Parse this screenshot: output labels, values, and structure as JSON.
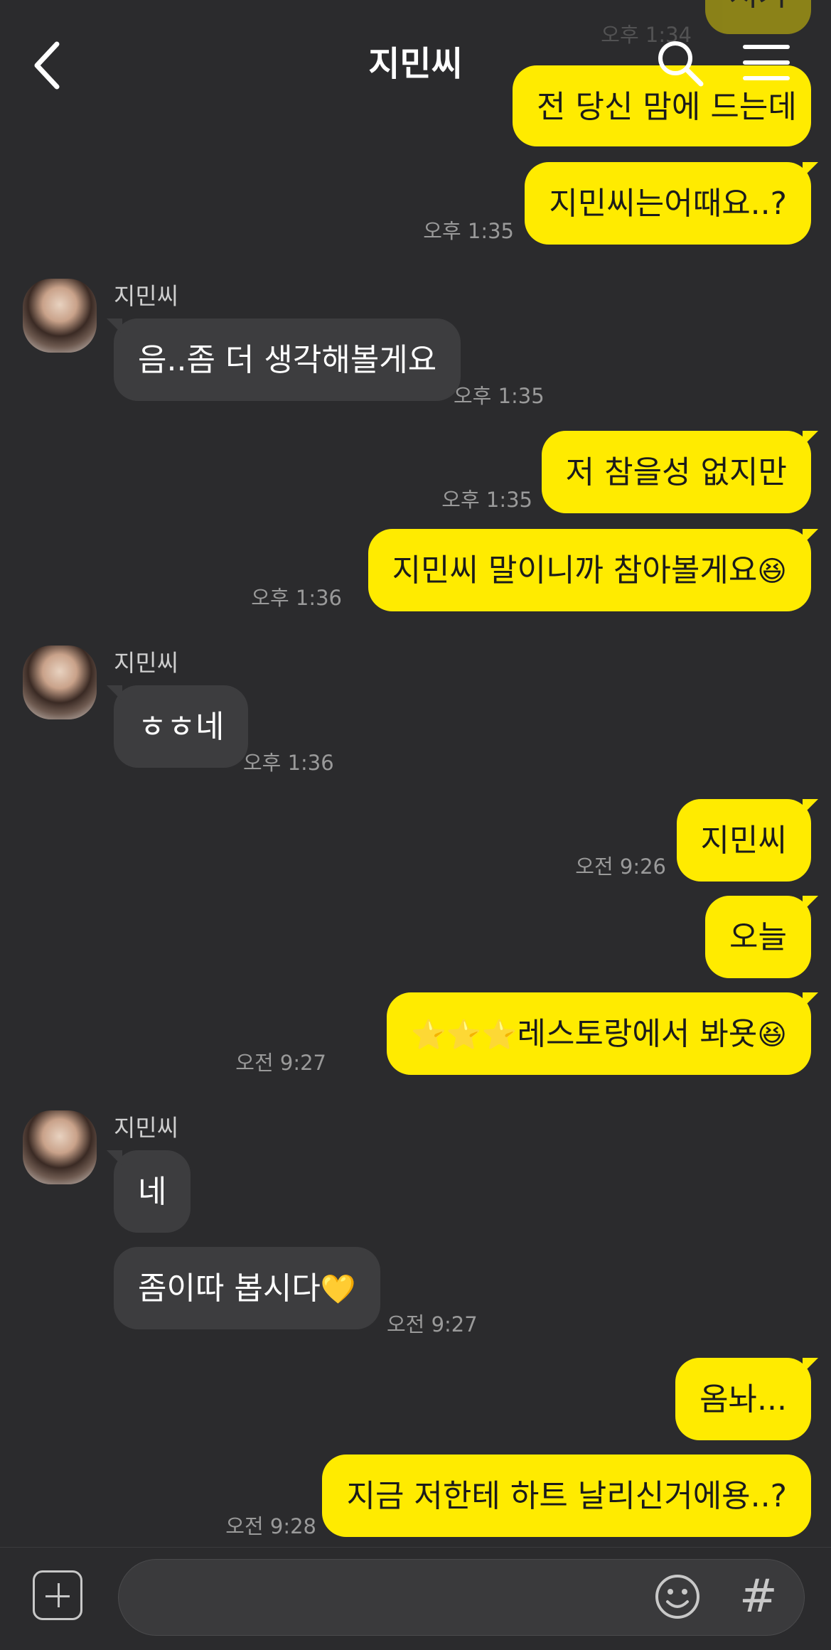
{
  "header": {
    "title": "지민씨"
  },
  "contact_name": "지민씨",
  "top_partial": {
    "bubble1": "저기",
    "time1": "오후 1:34",
    "bubble2": "전 당신 맘에 드는데"
  },
  "messages": [
    {
      "from": "me",
      "text": "지민씨는어때요..?",
      "time": "오후 1:35"
    },
    {
      "from": "other",
      "text": "음..좀 더 생각해볼게요",
      "time": "오후 1:35"
    },
    {
      "from": "me",
      "text": "저 참을성 없지만",
      "time": "오후 1:35"
    },
    {
      "from": "me",
      "text": "지민씨 말이니까 참아볼게요",
      "emoji": "😆",
      "time": "오후 1:36"
    },
    {
      "from": "other",
      "text": "ㅎㅎ네",
      "time": "오후 1:36"
    },
    {
      "from": "me",
      "text": "지민씨",
      "time": "오전 9:26"
    },
    {
      "from": "me",
      "text": "오늘"
    },
    {
      "from": "me",
      "prefix": "⭐⭐⭐",
      "text": "레스토랑에서 봐욧",
      "emoji": "😆",
      "time": "오전 9:27"
    },
    {
      "from": "other",
      "text": "네"
    },
    {
      "from": "other",
      "text": "좀이따 봅시다",
      "emoji": "💛",
      "time": "오전 9:27"
    },
    {
      "from": "me",
      "text": "옴놔..."
    },
    {
      "from": "me",
      "text": "지금 저한테 하트 날리신거에용..?",
      "time": "오전 9:28"
    }
  ],
  "input": {
    "placeholder": ""
  },
  "icons": {
    "back": "chevron-left-icon",
    "search": "search-icon",
    "menu": "menu-icon",
    "add": "plus-icon",
    "emoji": "smile-icon",
    "hash": "#"
  },
  "colors": {
    "background": "#2b2b2d",
    "my_bubble": "#ffeb00",
    "other_bubble": "#3d3d3f"
  }
}
